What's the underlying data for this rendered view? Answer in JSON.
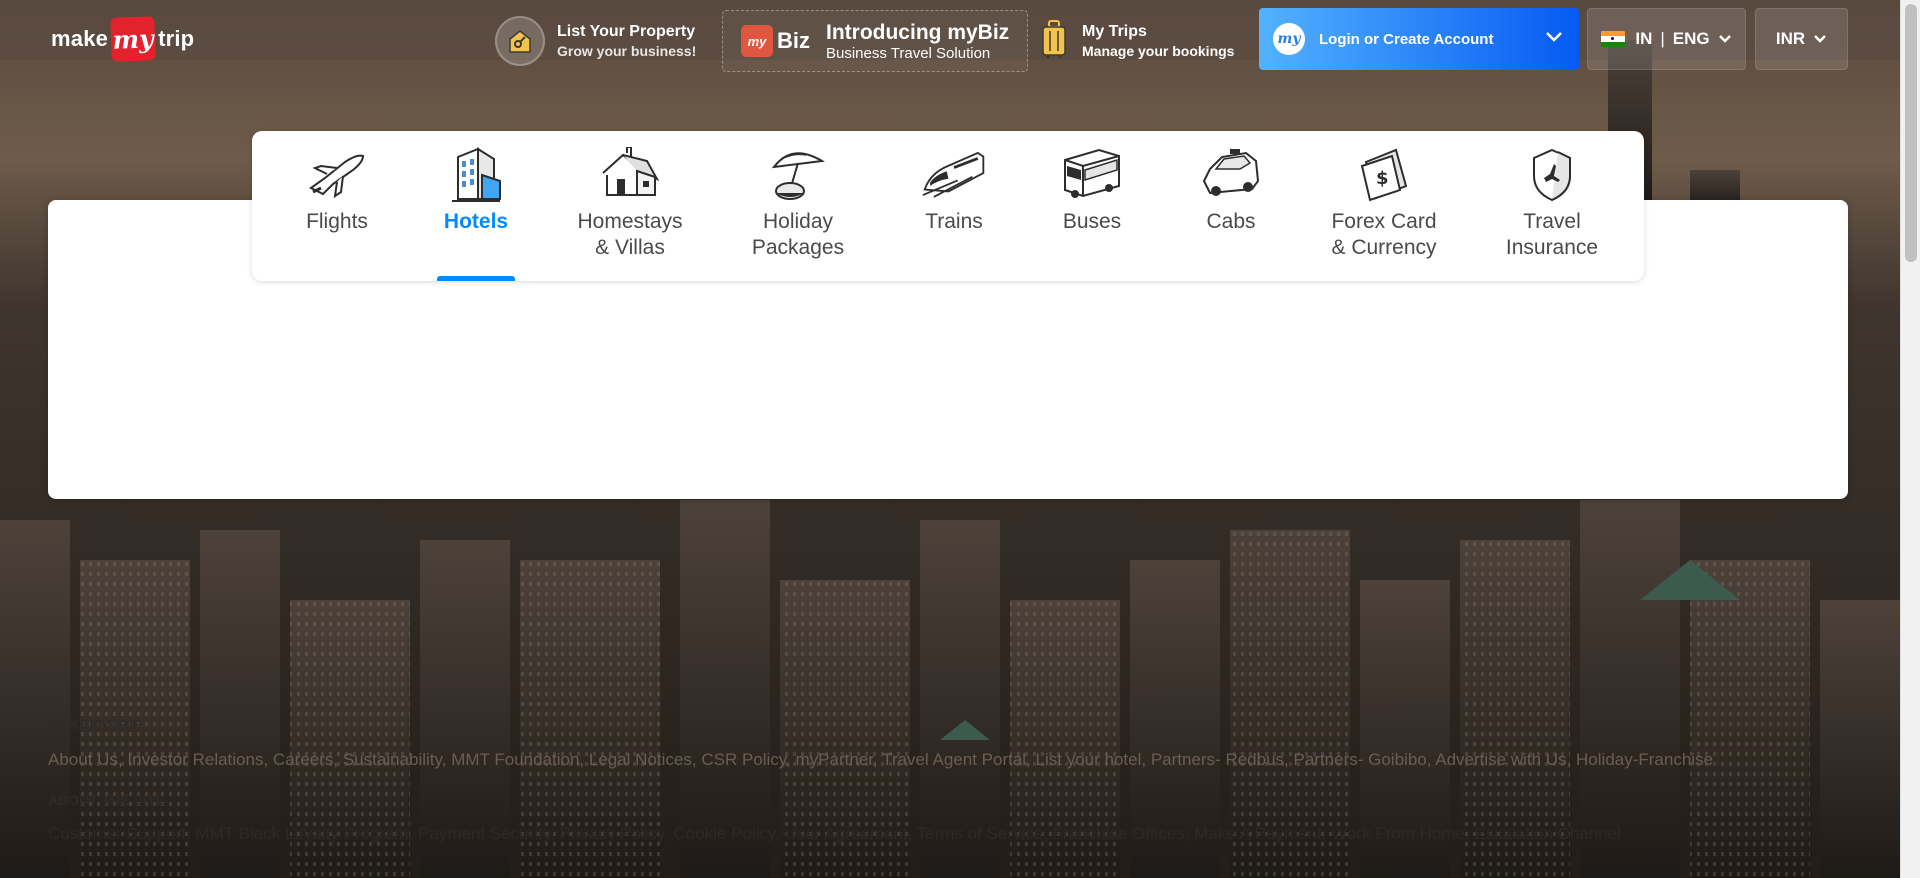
{
  "brand": {
    "make": "make",
    "my": "my",
    "trip": "trip"
  },
  "header": {
    "list_property": {
      "title": "List Your Property",
      "subtitle": "Grow your business!"
    },
    "mybiz": {
      "badge": "my",
      "logo": "Biz",
      "title": "Introducing myBiz",
      "subtitle": "Business Travel Solution"
    },
    "my_trips": {
      "title": "My Trips",
      "subtitle": "Manage your bookings"
    },
    "login": {
      "avatar": "my",
      "label": "Login or Create Account"
    },
    "locale": {
      "country": "IN",
      "separator": "|",
      "language": "ENG"
    },
    "currency": "INR"
  },
  "tabs": [
    {
      "id": "flights",
      "label": "Flights",
      "icon": "airplane-icon"
    },
    {
      "id": "hotels",
      "label": "Hotels",
      "icon": "hotel-building-icon",
      "active": true
    },
    {
      "id": "homestays",
      "label": "Homestays\n& Villas",
      "icon": "house-icon"
    },
    {
      "id": "holiday",
      "label": "Holiday\nPackages",
      "icon": "beach-umbrella-icon"
    },
    {
      "id": "trains",
      "label": "Trains",
      "icon": "train-icon"
    },
    {
      "id": "buses",
      "label": "Buses",
      "icon": "bus-icon"
    },
    {
      "id": "cabs",
      "label": "Cabs",
      "icon": "cab-icon"
    },
    {
      "id": "forex",
      "label": "Forex Card\n& Currency",
      "icon": "forex-card-icon"
    },
    {
      "id": "insurance",
      "label": "Travel\nInsurance",
      "icon": "insurance-shield-icon"
    }
  ],
  "footer": {
    "sections": [
      {
        "heading": "MAKEMYTRIP",
        "links": [
          "About Us",
          "Investor Relations",
          "Careers",
          "Sustainability",
          "MMT Foundation",
          "Legal Notices",
          "CSR Policy",
          "myPartner",
          "Travel Agent Portal",
          "List your hotel",
          "Partners- Redbus",
          "Partners- Goibibo",
          "Advertise with Us",
          "Holiday-Franchise"
        ]
      },
      {
        "heading": "ABOUT THE SITE",
        "links": [
          "Customer Support",
          "MMT Black Loyalty Program",
          "Payment Security",
          "Privacy Policy",
          "Cookie Policy",
          "User Agreement",
          "Terms of Service",
          "Franchise Offices",
          "Make A Payment",
          "Work From Home",
          "Escalation Channel"
        ]
      }
    ]
  },
  "colors": {
    "accent": "#008cff",
    "brand_red": "#e4222e",
    "login_gradient_start": "#53b2fe",
    "login_gradient_end": "#065af3"
  }
}
